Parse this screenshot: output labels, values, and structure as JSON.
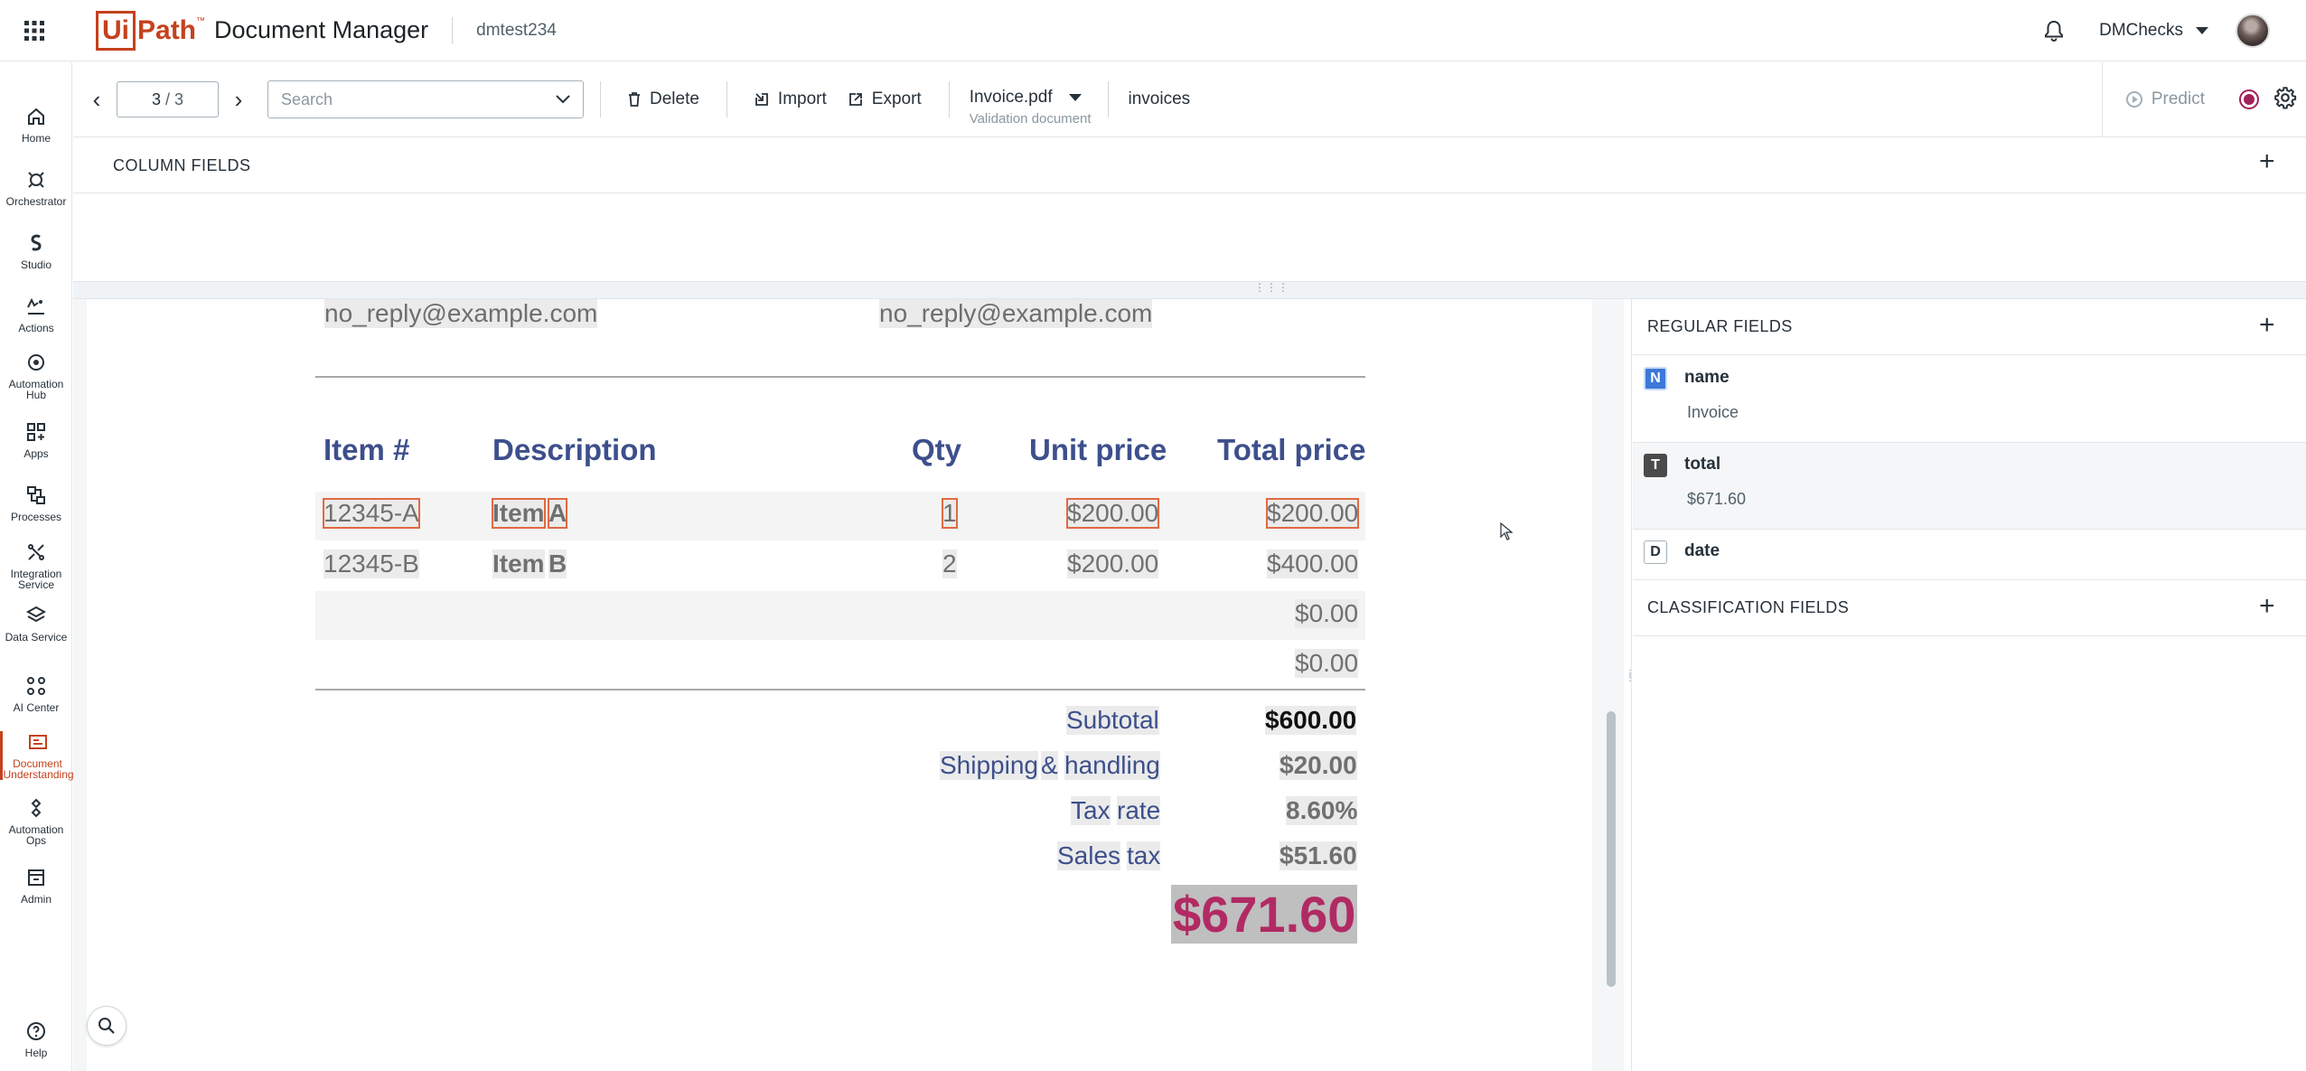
{
  "header": {
    "logo_box": "Ui",
    "logo_path": "Path",
    "logo_tm": "™",
    "product": "Document Manager",
    "tenant": "dmtest234",
    "account": "DMChecks"
  },
  "nav": [
    {
      "label": "Home",
      "icon": "home-icon"
    },
    {
      "label": "Orchestrator",
      "icon": "orchestrator-icon"
    },
    {
      "label": "Studio",
      "icon": "studio-icon"
    },
    {
      "label": "Actions",
      "icon": "actions-icon"
    },
    {
      "label": "Automation Hub",
      "icon": "automation-hub-icon"
    },
    {
      "label": "Apps",
      "icon": "apps-icon"
    },
    {
      "label": "Processes",
      "icon": "processes-icon"
    },
    {
      "label": "Integration Service",
      "icon": "integration-service-icon"
    },
    {
      "label": "Data Service",
      "icon": "data-service-icon"
    },
    {
      "label": "AI Center",
      "icon": "ai-center-icon"
    },
    {
      "label": "Document Understanding",
      "icon": "document-understanding-icon",
      "active": true
    },
    {
      "label": "Automation Ops",
      "icon": "automation-ops-icon"
    },
    {
      "label": "Admin",
      "icon": "admin-icon"
    },
    {
      "label": "Help",
      "icon": "help-icon"
    }
  ],
  "toolbar": {
    "page_current": "3",
    "page_total": "/ 3",
    "search_placeholder": "Search",
    "delete": "Delete",
    "import": "Import",
    "export": "Export",
    "file_name": "Invoice.pdf",
    "file_sub": "Validation document",
    "doc_type": "invoices",
    "predict": "Predict"
  },
  "column_fields": {
    "title": "COLUMN FIELDS"
  },
  "document": {
    "email_left": "no_reply@example.com",
    "email_right": "no_reply@example.com",
    "headers": [
      "Item #",
      "Description",
      "Qty",
      "Unit price",
      "Total price"
    ],
    "rows": [
      {
        "item": "12345-A",
        "desc_word": "Item",
        "desc_letter": "A",
        "qty": "1",
        "unit": "$200.00",
        "total": "$200.00"
      },
      {
        "item": "12345-B",
        "desc_word": "Item",
        "desc_letter": "B",
        "qty": "2",
        "unit": "$200.00",
        "total": "$400.00"
      },
      {
        "item": "",
        "desc_word": "",
        "desc_letter": "",
        "qty": "",
        "unit": "",
        "total": "$0.00"
      },
      {
        "item": "",
        "desc_word": "",
        "desc_letter": "",
        "qty": "",
        "unit": "",
        "total": "$0.00"
      }
    ],
    "totals": {
      "subtotal_label": "Subtotal",
      "subtotal": "$600.00",
      "shipping_label_1": "Shipping",
      "shipping_label_amp": "&",
      "shipping_label_2": "handling",
      "shipping": "$20.00",
      "tax_rate_label_1": "Tax",
      "tax_rate_label_2": "rate",
      "tax_rate": "8.60%",
      "sales_tax_label_1": "Sales",
      "sales_tax_label_2": "tax",
      "sales_tax": "$51.60",
      "grand_total": "$671.60"
    }
  },
  "regular_fields": {
    "title": "REGULAR FIELDS",
    "items": [
      {
        "type": "N",
        "type_color": "#3c78d8",
        "name": "name",
        "value": "Invoice"
      },
      {
        "type": "T",
        "type_color": "#4a4a4a",
        "name": "total",
        "value": "$671.60"
      },
      {
        "type": "D",
        "type_color": "#ffffff",
        "name": "date",
        "value": ""
      }
    ]
  },
  "classification_fields": {
    "title": "CLASSIFICATION FIELDS"
  }
}
